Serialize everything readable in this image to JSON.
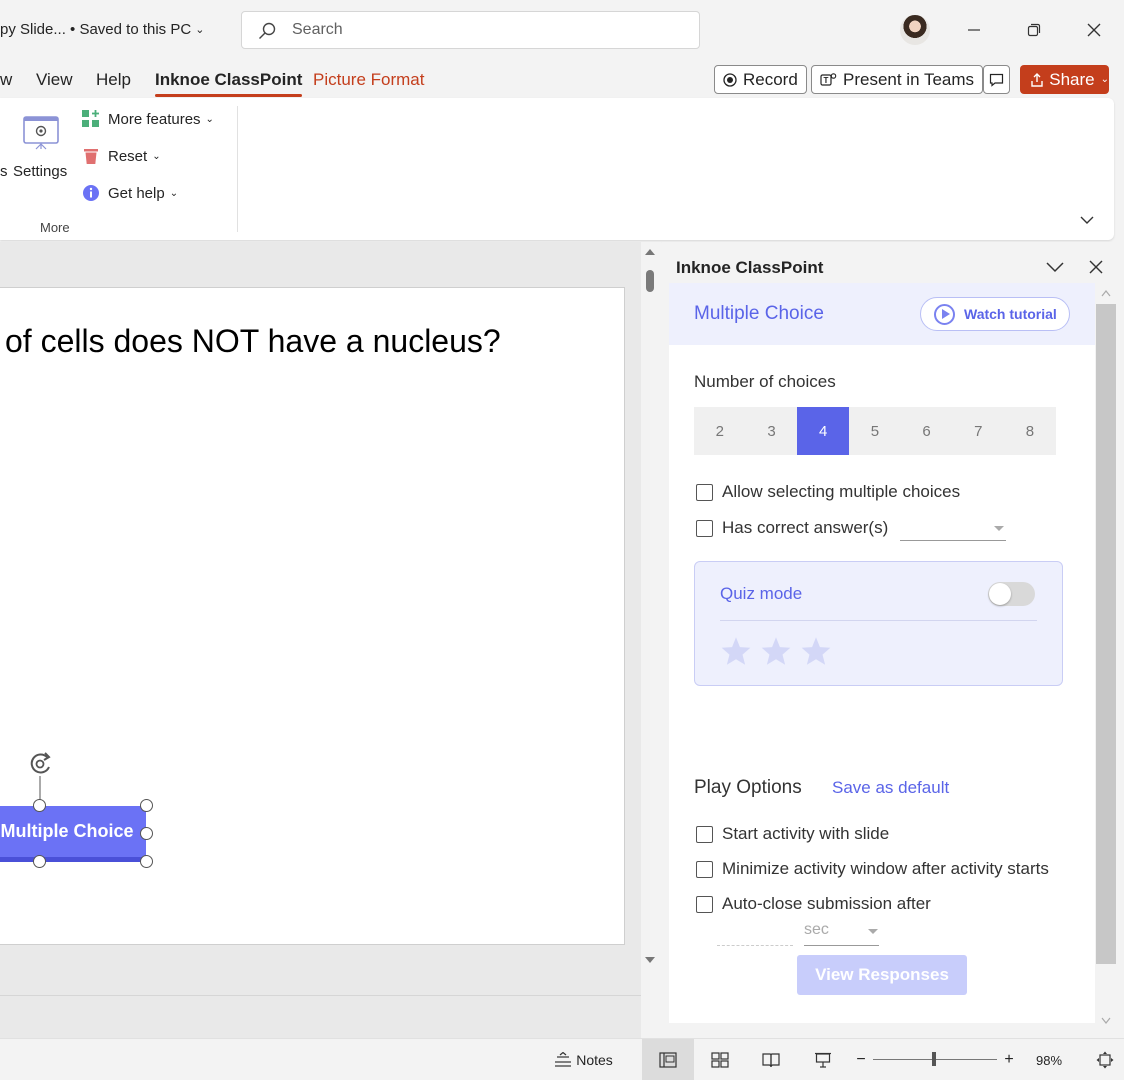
{
  "titlebar": {
    "doc_title": "py Slide... • Saved to this PC",
    "search_placeholder": "Search"
  },
  "tabs": [
    "w",
    "View",
    "Help",
    "Inknoe ClassPoint",
    "Picture Format"
  ],
  "top_actions": {
    "record": "Record",
    "present_in_teams": "Present in Teams",
    "share": "Share"
  },
  "ribbon": {
    "partial_label": "s",
    "settings": "Settings",
    "more_features": "More features",
    "reset": "Reset",
    "get_help": "Get help",
    "group_label": "More"
  },
  "slide": {
    "title": "of cells does NOT have a nucleus?",
    "button_label": "Multiple Choice"
  },
  "pane": {
    "title": "Inknoe ClassPoint",
    "activity_title": "Multiple Choice",
    "watch_tutorial": "Watch tutorial",
    "number_of_choices_label": "Number of choices",
    "choices": [
      "2",
      "3",
      "4",
      "5",
      "6",
      "7",
      "8"
    ],
    "selected_choice": "4",
    "allow_multiple": "Allow selecting multiple choices",
    "has_correct_answer": "Has correct answer(s)",
    "quiz_mode": "Quiz mode",
    "quiz_mode_on": false,
    "play_options": "Play Options",
    "save_as_default": "Save as default",
    "start_with_slide": "Start activity with slide",
    "minimize_window": "Minimize activity window after activity starts",
    "auto_close": "Auto-close submission after",
    "sec_unit": "sec",
    "view_responses": "View Responses"
  },
  "status": {
    "notes": "Notes",
    "zoom": "98%"
  },
  "colors": {
    "accent": "#c43e1c",
    "classpoint": "#5a64e8",
    "slide_button": "#6b72f5"
  }
}
